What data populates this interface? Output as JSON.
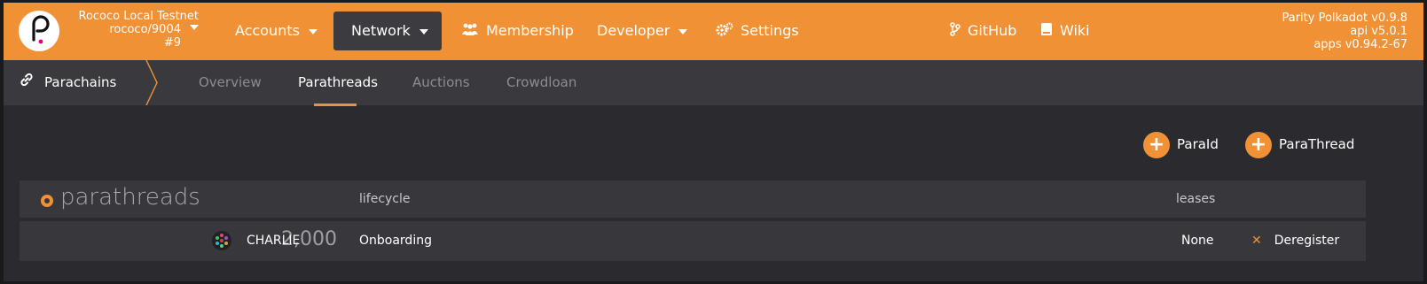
{
  "chain": {
    "name": "Rococo Local Testnet",
    "endpoint": "rococo/9004",
    "block": "#9"
  },
  "nav": {
    "accounts": "Accounts",
    "network": "Network",
    "membership": "Membership",
    "developer": "Developer",
    "settings": "Settings",
    "github": "GitHub",
    "wiki": "Wiki"
  },
  "versions": {
    "node": "Parity Polkadot v0.9.8",
    "api": "api v5.0.1",
    "apps": "apps v0.94.2-67"
  },
  "subnav": {
    "section": "Parachains",
    "tabs": [
      "Overview",
      "Parathreads",
      "Auctions",
      "Crowdloan"
    ],
    "active_tab": "Parathreads"
  },
  "actions": {
    "paraid": "ParaId",
    "parathread": "ParaThread"
  },
  "table": {
    "title": "parathreads",
    "columns": {
      "lifecycle": "lifecycle",
      "leases": "leases"
    },
    "rows": [
      {
        "id": "2,000",
        "account": "CHARLIE",
        "lifecycle": "Onboarding",
        "leases": "None",
        "action": "Deregister"
      }
    ]
  },
  "colors": {
    "accent": "#f19135",
    "background": "#2b2b2f",
    "table_row": "#38383c"
  },
  "icons": [
    "polkadot-logo-icon",
    "membership-icon",
    "settings-gear-icon",
    "git-branch-icon",
    "book-icon",
    "link-icon",
    "plus-icon",
    "close-icon",
    "identicon"
  ]
}
